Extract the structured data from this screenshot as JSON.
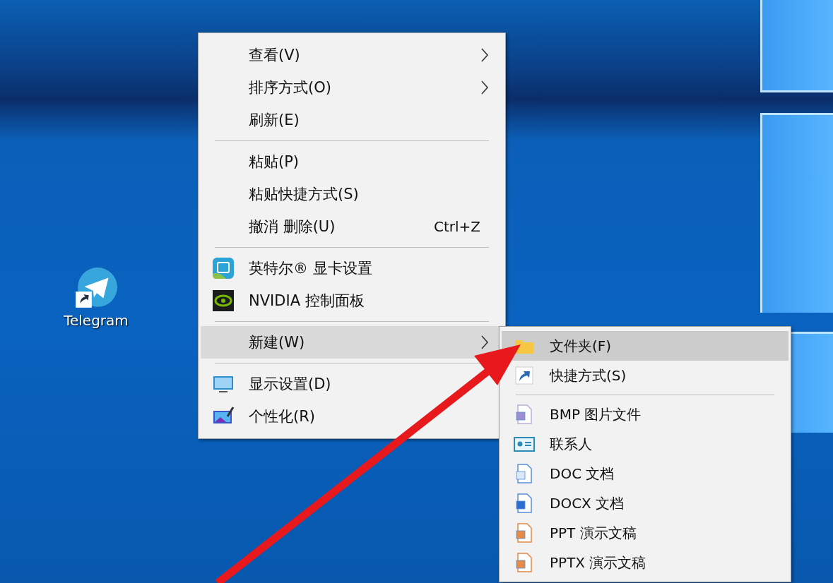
{
  "desktop_icons": [
    {
      "label": "Telegram"
    }
  ],
  "context_menu": {
    "items": [
      {
        "kind": "item",
        "label": "查看(V)",
        "has_submenu": true,
        "selected": false
      },
      {
        "kind": "item",
        "label": "排序方式(O)",
        "has_submenu": true,
        "selected": false
      },
      {
        "kind": "item",
        "label": "刷新(E)",
        "has_submenu": false,
        "selected": false
      },
      {
        "kind": "separator"
      },
      {
        "kind": "item",
        "label": "粘贴(P)",
        "has_submenu": false,
        "selected": false
      },
      {
        "kind": "item",
        "label": "粘贴快捷方式(S)",
        "has_submenu": false,
        "selected": false
      },
      {
        "kind": "item",
        "label": "撤消 删除(U)",
        "shortcut": "Ctrl+Z",
        "has_submenu": false,
        "selected": false
      },
      {
        "kind": "separator"
      },
      {
        "kind": "item",
        "label": "英特尔® 显卡设置",
        "has_submenu": false,
        "selected": false
      },
      {
        "kind": "item",
        "label": "NVIDIA 控制面板",
        "has_submenu": false,
        "selected": false
      },
      {
        "kind": "separator"
      },
      {
        "kind": "item",
        "label": "新建(W)",
        "has_submenu": true,
        "selected": true
      },
      {
        "kind": "separator"
      },
      {
        "kind": "item",
        "label": "显示设置(D)",
        "has_submenu": false,
        "selected": false
      },
      {
        "kind": "item",
        "label": "个性化(R)",
        "has_submenu": false,
        "selected": false
      }
    ]
  },
  "submenu": {
    "items": [
      {
        "kind": "item",
        "label": "文件夹(F)",
        "selected": true
      },
      {
        "kind": "item",
        "label": "快捷方式(S)",
        "selected": false
      },
      {
        "kind": "separator"
      },
      {
        "kind": "item",
        "label": "BMP 图片文件",
        "selected": false
      },
      {
        "kind": "item",
        "label": "联系人",
        "selected": false
      },
      {
        "kind": "item",
        "label": "DOC 文档",
        "selected": false
      },
      {
        "kind": "item",
        "label": "DOCX 文档",
        "selected": false
      },
      {
        "kind": "item",
        "label": "PPT 演示文稿",
        "selected": false
      },
      {
        "kind": "item",
        "label": "PPTX 演示文稿",
        "selected": false
      }
    ]
  }
}
